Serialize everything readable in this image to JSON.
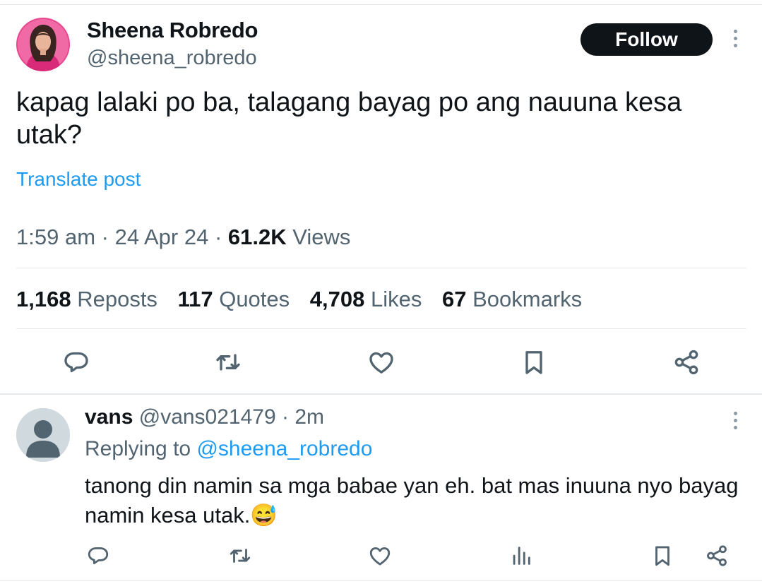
{
  "author": {
    "display_name": "Sheena Robredo",
    "handle": "@sheena_robredo",
    "avatar_icon": "profile-photo"
  },
  "follow_label": "Follow",
  "tweet": {
    "text": "kapag lalaki po ba, talagang bayag po ang nauuna kesa utak?",
    "translate_label": "Translate post",
    "time": "1:59 am",
    "date": "24 Apr 24",
    "views_count": "61.2K",
    "views_label": "Views",
    "separator": "·"
  },
  "stats": [
    {
      "count": "1,168",
      "label": "Reposts"
    },
    {
      "count": "117",
      "label": "Quotes"
    },
    {
      "count": "4,708",
      "label": "Likes"
    },
    {
      "count": "67",
      "label": "Bookmarks"
    }
  ],
  "actions": [
    "reply-icon",
    "repost-icon",
    "like-icon",
    "bookmark-icon",
    "share-icon"
  ],
  "reply": {
    "display_name": "vans",
    "handle": "@vans021479",
    "age": "· 2m",
    "replying_prefix": "Replying to",
    "replying_to": "@sheena_robredo",
    "text": "tanong din namin sa mga babae yan eh. bat mas inuuna nyo bayag namin kesa utak.",
    "emoji": "😅",
    "actions": [
      "reply-icon",
      "repost-icon",
      "like-icon",
      "analytics-icon",
      "bookmark-icon",
      "share-icon"
    ]
  },
  "colors": {
    "text": "#0f1419",
    "secondary": "#536471",
    "link": "#1d9bf0",
    "divider": "#e6e9ec",
    "follow_bg": "#0f1419"
  }
}
